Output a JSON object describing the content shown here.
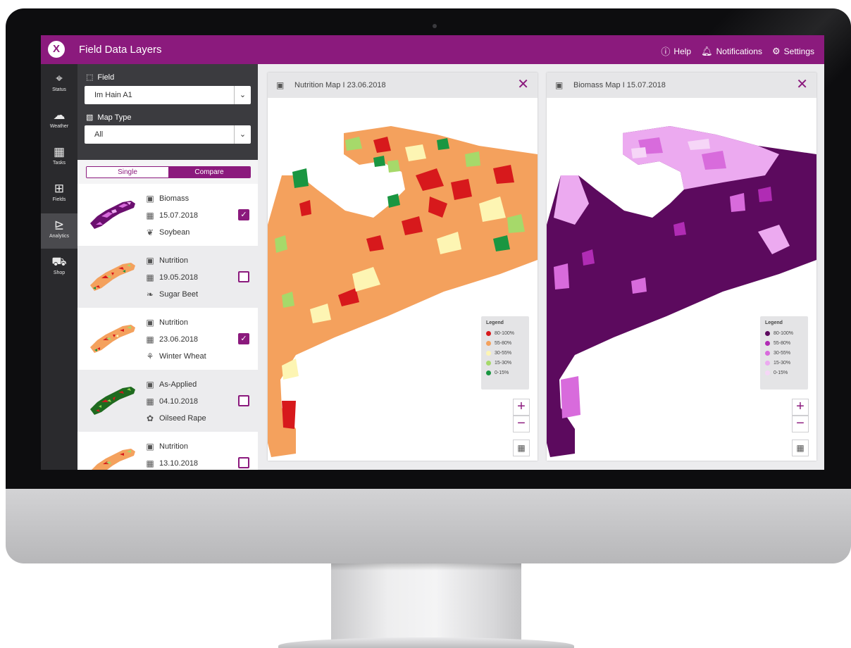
{
  "app": {
    "title": "Field Data Layers",
    "logo_glyph": "X"
  },
  "topbar": {
    "help": "Help",
    "notifications": "Notifications",
    "settings": "Settings"
  },
  "sidenav": [
    {
      "label": "Status",
      "icon": "map-pin-icon"
    },
    {
      "label": "Weather",
      "icon": "cloud-sun-icon"
    },
    {
      "label": "Tasks",
      "icon": "calendar-grid-icon"
    },
    {
      "label": "Fields",
      "icon": "fields-grid-icon"
    },
    {
      "label": "Analytics",
      "icon": "analytics-chart-icon",
      "active": true
    },
    {
      "label": "Shop",
      "icon": "cart-icon"
    }
  ],
  "filters": {
    "field_label": "Field",
    "field_value": "Im Hain A1",
    "map_type_label": "Map Type",
    "map_type_value": "All"
  },
  "mode_toggle": {
    "single": "Single",
    "compare": "Compare",
    "selected": "Compare"
  },
  "layers": [
    {
      "type": "Biomass",
      "date": "15.07.2018",
      "crop": "Soybean",
      "checked": true,
      "thumb": "purple"
    },
    {
      "type": "Nutrition",
      "date": "19.05.2018",
      "crop": "Sugar Beet",
      "checked": false,
      "thumb": "orange"
    },
    {
      "type": "Nutrition",
      "date": "23.06.2018",
      "crop": "Winter Wheat",
      "checked": true,
      "thumb": "orange"
    },
    {
      "type": "As-Applied",
      "date": "04.10.2018",
      "crop": "Oilseed Rape",
      "checked": false,
      "thumb": "green"
    },
    {
      "type": "Nutrition",
      "date": "13.10.2018",
      "crop": "",
      "checked": false,
      "thumb": "orange"
    }
  ],
  "maps": [
    {
      "title": "Nutrition Map I 23.06.2018",
      "legend_title": "Legend",
      "legend": [
        {
          "label": "80-100%",
          "color": "#d7191c"
        },
        {
          "label": "55-80%",
          "color": "#f4a15d"
        },
        {
          "label": "30-55%",
          "color": "#fdf5b3"
        },
        {
          "label": "15-30%",
          "color": "#a6d96a"
        },
        {
          "label": "0-15%",
          "color": "#1a9641"
        }
      ]
    },
    {
      "title": "Biomass Map I 15.07.2018",
      "legend_title": "Legend",
      "legend": [
        {
          "label": "80-100%",
          "color": "#5c0a5e"
        },
        {
          "label": "55-80%",
          "color": "#b02cb4"
        },
        {
          "label": "30-55%",
          "color": "#d86bdc"
        },
        {
          "label": "15-30%",
          "color": "#ecaaf0"
        },
        {
          "label": "0-15%",
          "color": "#f6d6f7"
        }
      ]
    }
  ],
  "zoom": {
    "in": "+",
    "out": "−"
  },
  "colors": {
    "brand": "#8b1a7d",
    "sidenav": "#2a2a2d",
    "filters": "#3b3b3f"
  }
}
